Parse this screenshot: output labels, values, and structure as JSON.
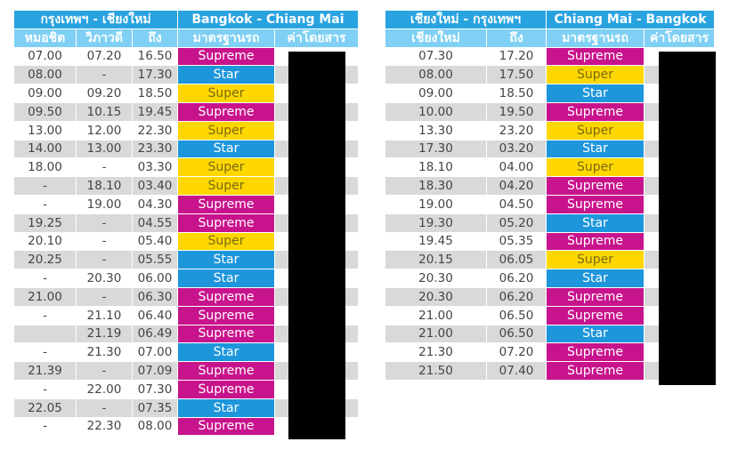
{
  "colors": {
    "Supreme": {
      "bg": "#c8148c",
      "fg": "#ffffff"
    },
    "Star": {
      "bg": "#1e96dc",
      "fg": "#ffffff"
    },
    "Super": {
      "bg": "#ffd700",
      "fg": "#7a6a10"
    }
  },
  "table1": {
    "title_th": "กรุงเทพฯ - เชียงใหม่",
    "title_en": "Bangkok - Chiang Mai",
    "headers": [
      "หมอชิต",
      "วิภาวดี",
      "ถึง",
      "มาตรฐานรถ",
      "ค่าโดยสาร"
    ],
    "rows": [
      [
        "07.00",
        "07.20",
        "16.50",
        "Supreme"
      ],
      [
        "08.00",
        "-",
        "17.30",
        "Star"
      ],
      [
        "09.00",
        "09.20",
        "18.50",
        "Super"
      ],
      [
        "09.50",
        "10.15",
        "19.45",
        "Supreme"
      ],
      [
        "13.00",
        "12.00",
        "22.30",
        "Super"
      ],
      [
        "14.00",
        "13.00",
        "23.30",
        "Star"
      ],
      [
        "18.00",
        "-",
        "03.30",
        "Super"
      ],
      [
        "-",
        "18.10",
        "03.40",
        "Super"
      ],
      [
        "-",
        "19.00",
        "04.30",
        "Supreme"
      ],
      [
        "19.25",
        "-",
        "04.55",
        "Supreme"
      ],
      [
        "20.10",
        "-",
        "05.40",
        "Super"
      ],
      [
        "20.25",
        "-",
        "05.55",
        "Star"
      ],
      [
        "-",
        "20.30",
        "06.00",
        "Star"
      ],
      [
        "21.00",
        "-",
        "06.30",
        "Supreme"
      ],
      [
        "-",
        "21.10",
        "06.40",
        "Supreme"
      ],
      [
        "",
        "21.19",
        "06.49",
        "Supreme"
      ],
      [
        "-",
        "21.30",
        "07.00",
        "Star"
      ],
      [
        "21.39",
        "-",
        "07.09",
        "Supreme"
      ],
      [
        "-",
        "22.00",
        "07.30",
        "Supreme"
      ],
      [
        "22.05",
        "-",
        "07.35",
        "Star"
      ],
      [
        "-",
        "22.30",
        "08.00",
        "Supreme"
      ]
    ]
  },
  "table2": {
    "title_th": "เชียงใหม่ - กรุงเทพฯ",
    "title_en": "Chiang Mai - Bangkok",
    "headers": [
      "เชียงใหม่",
      "ถึง",
      "มาตรฐานรถ",
      "ค่าโดยสาร"
    ],
    "rows": [
      [
        "07.30",
        "17.20",
        "Supreme"
      ],
      [
        "08.00",
        "17.50",
        "Super"
      ],
      [
        "09.00",
        "18.50",
        "Star"
      ],
      [
        "10.00",
        "19.50",
        "Supreme"
      ],
      [
        "13.30",
        "23.20",
        "Super"
      ],
      [
        "17.30",
        "03.20",
        "Star"
      ],
      [
        "18.10",
        "04.00",
        "Super"
      ],
      [
        "18.30",
        "04.20",
        "Supreme"
      ],
      [
        "19.00",
        "04.50",
        "Supreme"
      ],
      [
        "19.30",
        "05.20",
        "Star"
      ],
      [
        "19.45",
        "05.35",
        "Supreme"
      ],
      [
        "20.15",
        "06.05",
        "Super"
      ],
      [
        "20.30",
        "06.20",
        "Star"
      ],
      [
        "20.30",
        "06.20",
        "Supreme"
      ],
      [
        "21.00",
        "06.50",
        "Supreme"
      ],
      [
        "21.00",
        "06.50",
        "Star"
      ],
      [
        "21.30",
        "07.20",
        "Supreme"
      ],
      [
        "21.50",
        "07.40",
        "Supreme"
      ]
    ]
  }
}
